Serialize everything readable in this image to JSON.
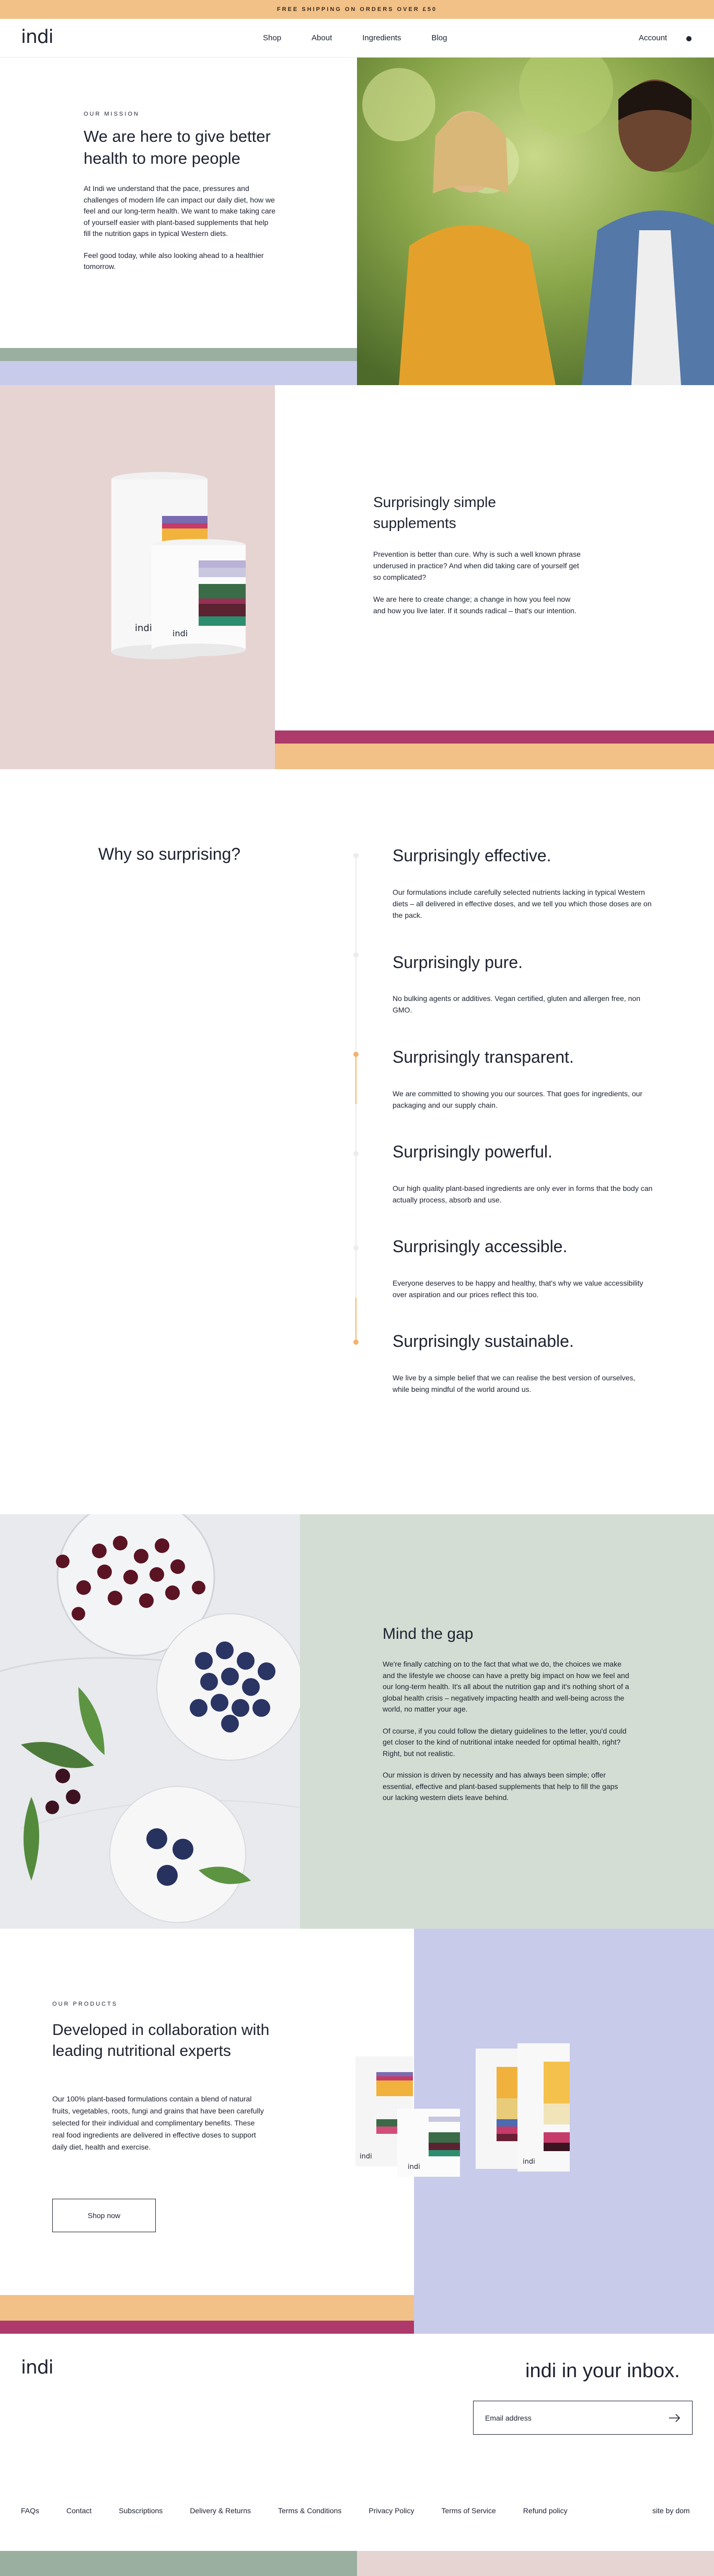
{
  "promo": {
    "text": "FREE SHIPPING ON ORDERS OVER £50"
  },
  "header": {
    "logo": "indi",
    "nav": [
      "Shop",
      "About",
      "Ingredients",
      "Blog"
    ],
    "account": "Account"
  },
  "mission": {
    "eyebrow": "OUR MISSION",
    "title": "We are here to give better health to more people",
    "paragraphs": [
      "At Indi we understand that the pace, pressures and challenges of modern life can impact our daily diet, how we feel and our long-term health. We want to make taking care of yourself easier with plant-based supplements that help fill the nutrition gaps in typical Western diets.",
      "Feel good today, while also looking ahead to a healthier tomorrow."
    ]
  },
  "simple": {
    "title": "Surprisingly simple supplements",
    "paragraphs": [
      "Prevention is better than cure. Why is such a well known phrase underused in practice? And when did taking care of yourself get so complicated?",
      "We are here to create change; a change in how you feel now and how you live later. If it sounds radical – that's our intention."
    ],
    "jar_label": "indi"
  },
  "why": {
    "heading": "Why so surprising?",
    "items": [
      {
        "title": "Surprisingly effective.",
        "body": "Our formulations include carefully selected nutrients lacking in typical Western diets – all delivered in effective doses, and we tell you which those doses are on the pack."
      },
      {
        "title": "Surprisingly pure.",
        "body": "No bulking agents or additives. Vegan certified, gluten and allergen free, non GMO."
      },
      {
        "title": "Surprisingly transparent.",
        "body": "We are committed to showing you our sources. That goes for ingredients, our packaging and our supply chain."
      },
      {
        "title": "Surprisingly powerful.",
        "body": "Our high quality plant-based ingredients are only ever in forms that the body can actually process, absorb and use."
      },
      {
        "title": "Surprisingly accessible.",
        "body": "Everyone deserves to be happy and healthy, that's why we value accessibility over aspiration and our prices reflect this too."
      },
      {
        "title": "Surprisingly sustainable.",
        "body": "We live by a simple belief that we can realise the best version of ourselves, while being mindful of the world around us."
      }
    ]
  },
  "gap": {
    "title": "Mind the gap",
    "paragraphs": [
      "We're finally catching on to the fact that what we do, the choices we make and the lifestyle we choose can have a pretty big impact on how we feel and our long-term health. It's all about the nutrition gap and it's nothing short of a global health crisis – negatively impacting health and well-being across the world, no matter your age.",
      " Of course, if you could follow the dietary guidelines to the letter, you'd could get closer to the kind of nutritional intake needed for optimal health, right? Right, but not realistic.",
      " Our mission is driven by necessity and has always been simple; offer essential, effective and plant-based supplements that help to fill the gaps our lacking western diets leave behind."
    ]
  },
  "products": {
    "eyebrow": "OUR PRODUCTS",
    "title": "Developed in collaboration with leading nutritional experts",
    "body": "Our 100% plant-based formulations contain a blend of natural fruits, vegetables, roots, fungi and grains that have been carefully selected for their individual and complimentary benefits. These real food ingredients are delivered in effective doses to support daily diet, health and exercise.",
    "button": "Shop now",
    "jar_label": "indi"
  },
  "footer": {
    "logo": "indi",
    "inbox_title": "indi in your inbox.",
    "email_placeholder": "Email address",
    "links": [
      "FAQs",
      "Contact",
      "Subscriptions",
      "Delivery & Returns",
      "Terms & Conditions",
      "Privacy Policy",
      "Terms of Service",
      "Refund policy"
    ],
    "site_by": "site by dom"
  },
  "colors": {
    "promo": "#f2c188",
    "sage": "#9aaf9f",
    "lavender": "#c9cbea",
    "blush": "#e6d4d3",
    "magenta": "#ad3a6a",
    "mint": "#d3ddd3",
    "timeline_accent": "#f2b36a"
  }
}
